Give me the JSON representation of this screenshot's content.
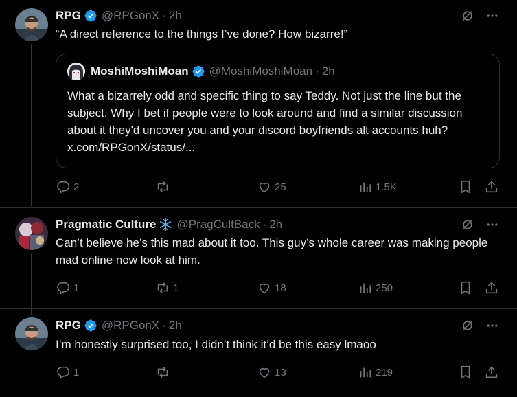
{
  "tweets": [
    {
      "name": "RPG",
      "handle": "@RPGonX",
      "time": "2h",
      "text": "“A direct reference to the things I’ve done? How bizarre!”",
      "badge": "verified-badge",
      "quote": {
        "name": "MoshiMoshiMoan",
        "handle": "@MoshiMoshiMoan",
        "time": "2h",
        "text": "What a bizarrely odd and specific thing to say Teddy.  Not just the line but the subject.  Why I bet if people were to look around and find a similar discussion about it they'd uncover you and your discord boyfriends alt accounts huh? x.com/RPGonX/status/..."
      },
      "replies": "2",
      "reposts": "",
      "likes": "25",
      "views": "1.5K"
    },
    {
      "name": "Pragmatic Culture",
      "name_emoji": "❄️",
      "handle": "@PragCultBack",
      "time": "2h",
      "text": "Can’t believe he’s this mad about it too. This guy’s whole career was making people mad online now look at him.",
      "replies": "1",
      "reposts": "1",
      "likes": "18",
      "views": "250"
    },
    {
      "name": "RPG",
      "handle": "@RPGonX",
      "time": "2h",
      "text": "I’m honestly surprised too, I didn’t think it’d be this easy lmaoo",
      "badge": "verified-badge",
      "replies": "1",
      "reposts": "",
      "likes": "13",
      "views": "219"
    }
  ],
  "separator": "·",
  "colors": {
    "verified": "#1d9bf0",
    "muted": "#71767b",
    "text": "#e7e9ea",
    "border": "#2f3336",
    "snowflake": "#5fb7f5"
  }
}
